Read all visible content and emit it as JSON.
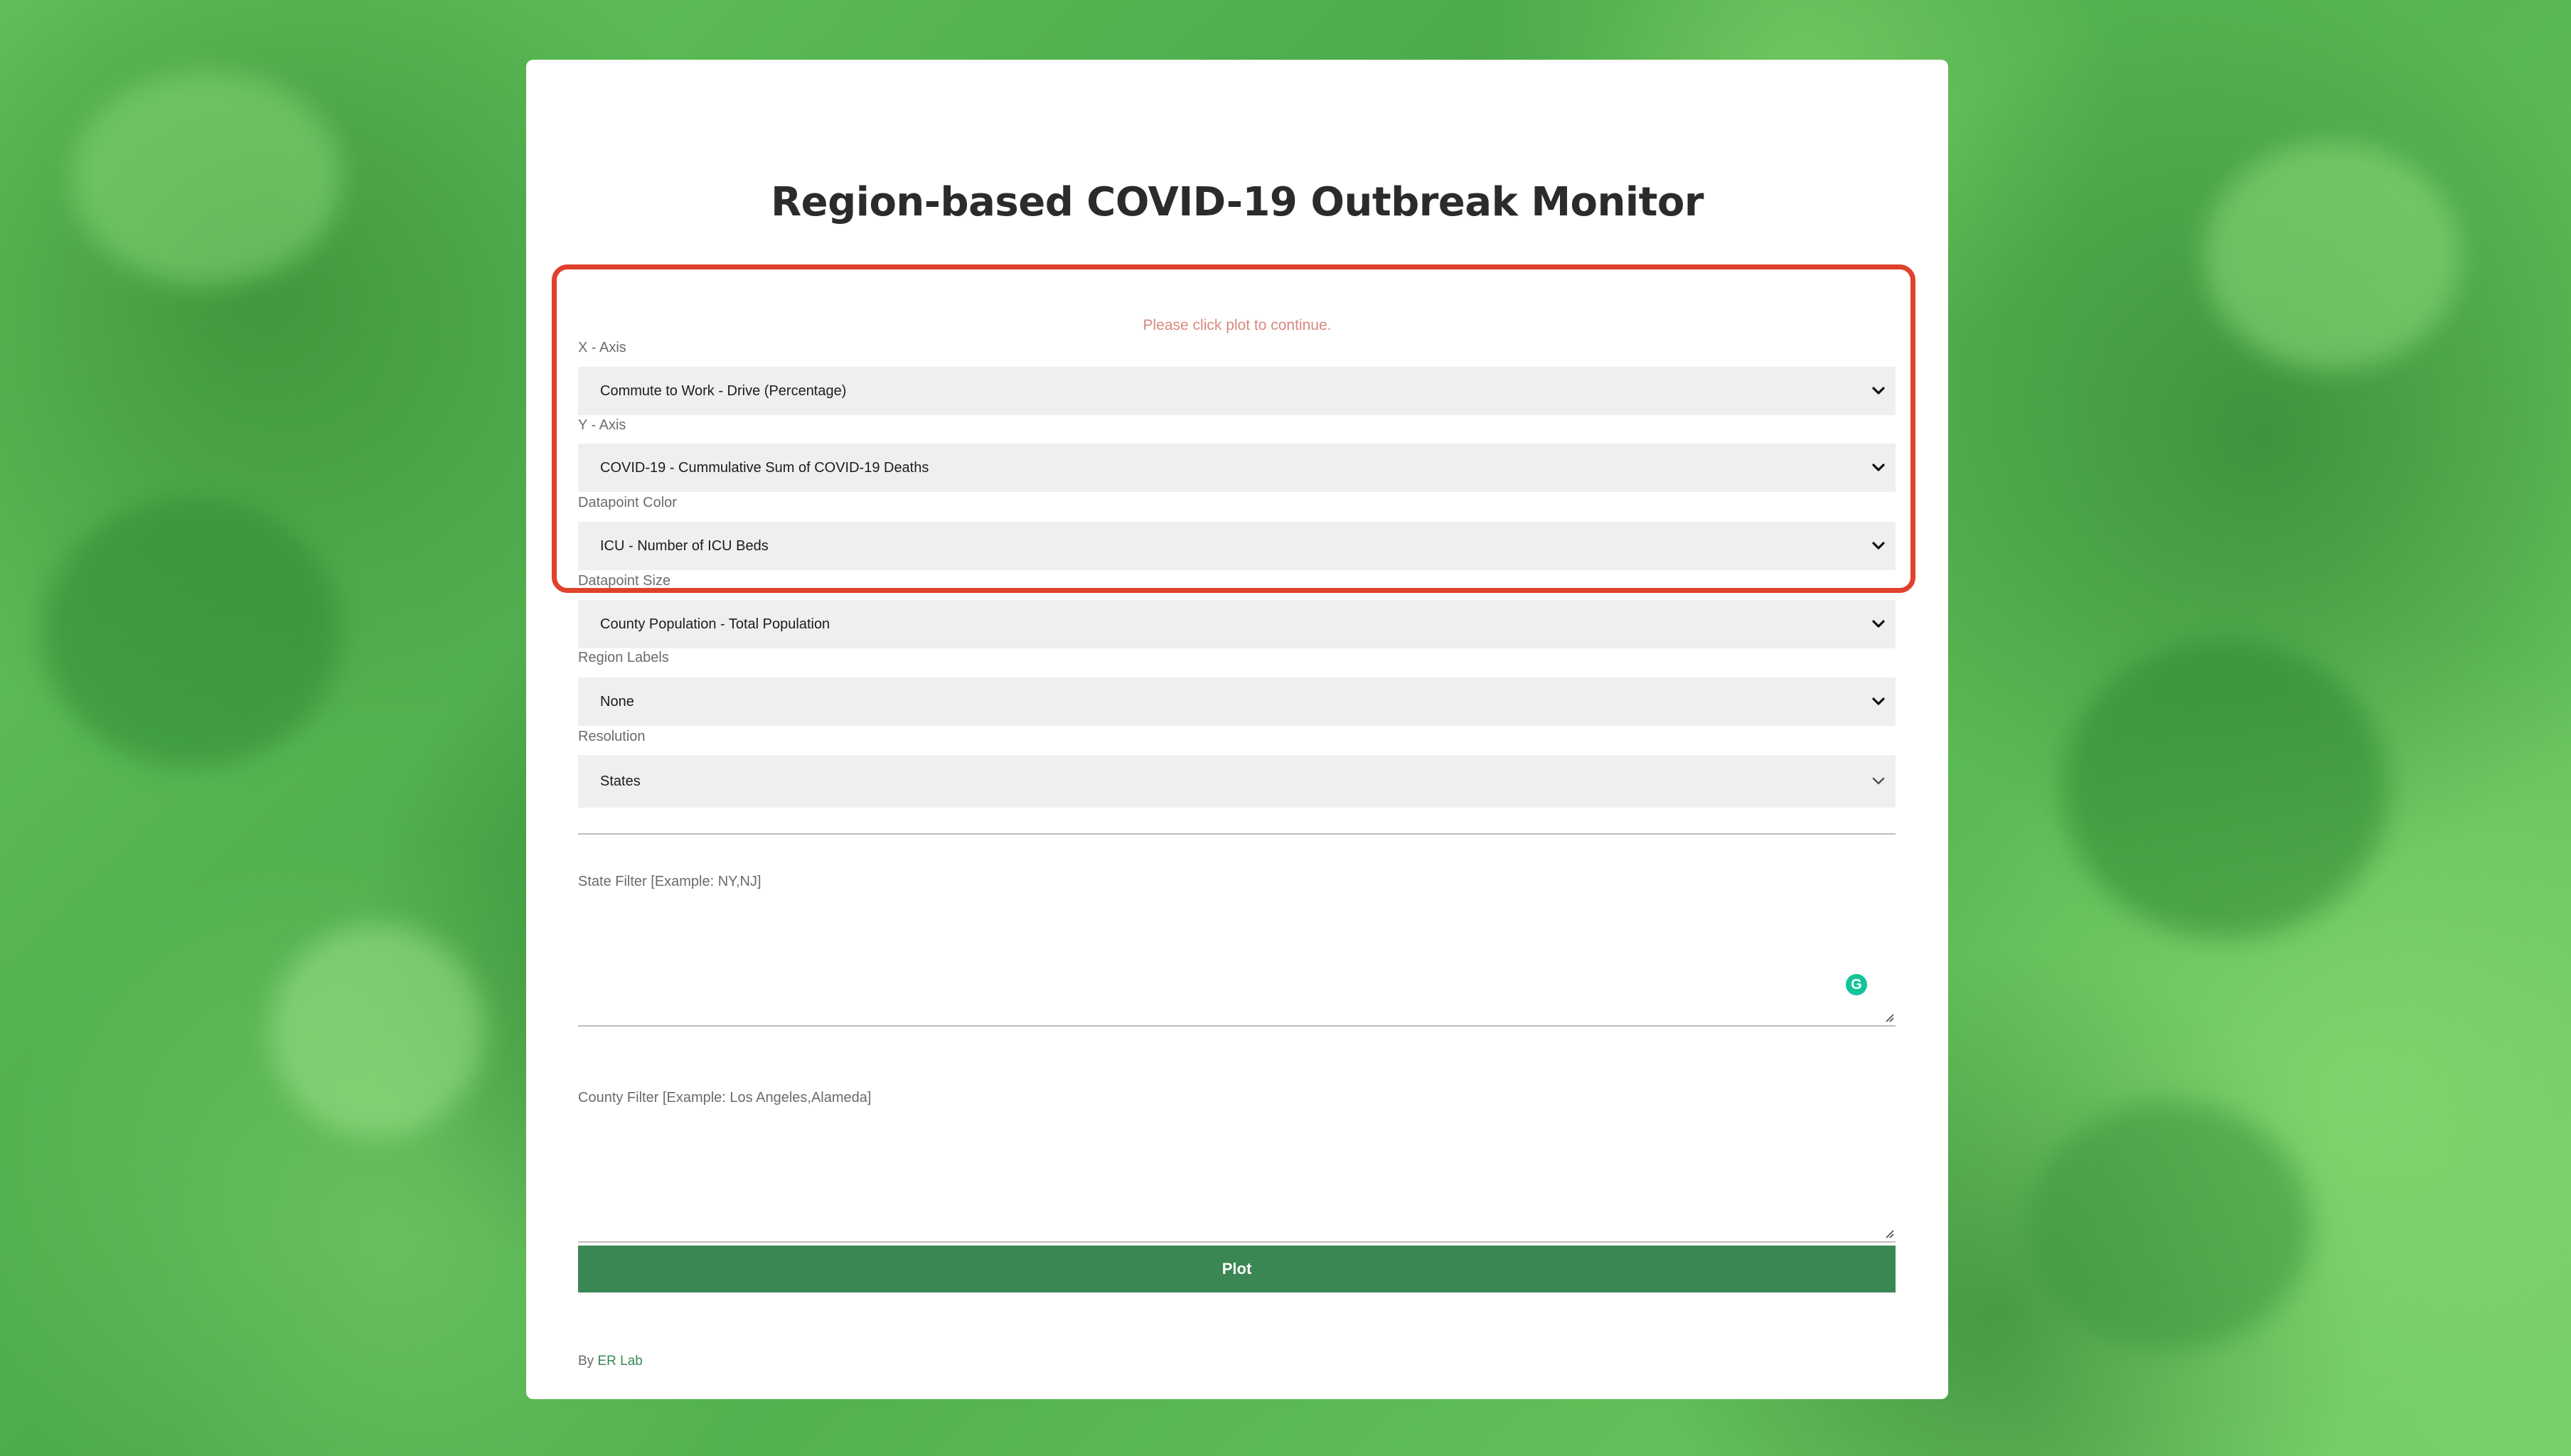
{
  "page": {
    "title": "Region-based COVID-19 Outbreak Monitor",
    "hint": "Please click plot to continue."
  },
  "form": {
    "x_axis": {
      "label": "X - Axis",
      "value": "Commute to Work - Drive (Percentage)"
    },
    "y_axis": {
      "label": "Y - Axis",
      "value": "COVID-19 - Cummulative Sum of COVID-19 Deaths"
    },
    "datapoint_color": {
      "label": "Datapoint Color",
      "value": "ICU - Number of ICU Beds"
    },
    "datapoint_size": {
      "label": "Datapoint Size",
      "value": "County Population - Total Population"
    },
    "region_labels": {
      "label": "Region Labels",
      "value": "None"
    },
    "resolution": {
      "label": "Resolution",
      "value": "States"
    },
    "state_filter": {
      "label": "State Filter [Example: NY,NJ]",
      "value": ""
    },
    "county_filter": {
      "label": "County Filter [Example: Los Angeles,Alameda]",
      "value": ""
    },
    "plot_button": "Plot"
  },
  "footer": {
    "prefix": "By ",
    "link": "ER Lab"
  },
  "icons": {
    "select_arrow": "chevron-down-icon",
    "grammarly": "grammarly-icon",
    "resize": "resize-grip-icon"
  },
  "colors": {
    "accent": "#3b8753",
    "highlight": "#e0412c",
    "background": "#5cbb56"
  }
}
